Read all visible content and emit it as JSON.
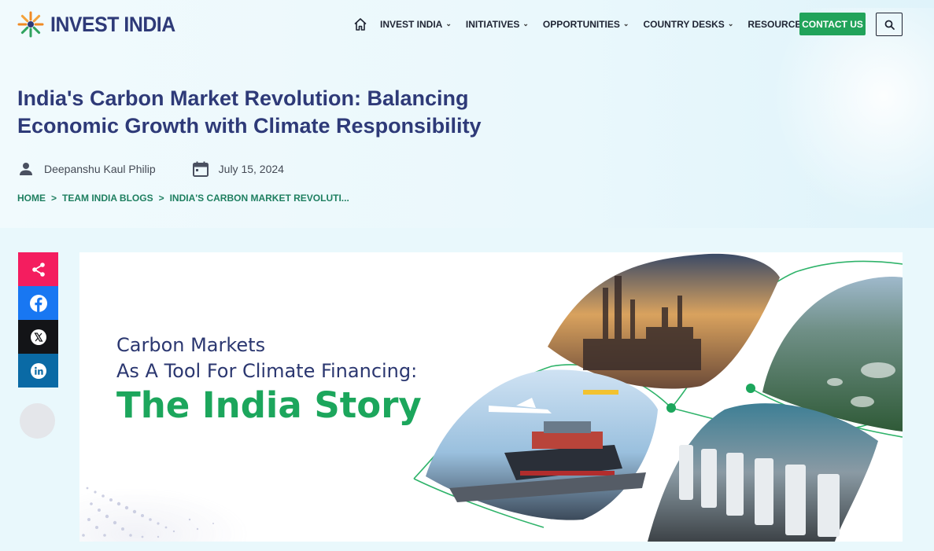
{
  "brand": {
    "name": "INVEST INDIA"
  },
  "nav": {
    "items": [
      {
        "label": "INVEST INDIA"
      },
      {
        "label": "INITIATIVES"
      },
      {
        "label": "OPPORTUNITIES"
      },
      {
        "label": "COUNTRY DESKS"
      },
      {
        "label": "RESOURCES"
      }
    ],
    "contact_label": "CONTACT US"
  },
  "article": {
    "title": "India's Carbon Market Revolution: Balancing Economic Growth with Climate Responsibility",
    "author": "Deepanshu Kaul Philip",
    "date": "July 15, 2024"
  },
  "breadcrumb": [
    {
      "label": "HOME"
    },
    {
      "label": "TEAM INDIA BLOGS"
    },
    {
      "label": "INDIA'S CARBON MARKET REVOLUTI..."
    }
  ],
  "banner": {
    "line1": "Carbon Markets",
    "line2": "As A Tool For Climate Financing:",
    "line3": "The India Story"
  },
  "colors": {
    "brand_navy": "#2e3a78",
    "accent_green": "#21a35a",
    "breadcrumb_green": "#1e7f60",
    "share_pink": "#f41d5f",
    "facebook_blue": "#1877f2",
    "x_black": "#131417",
    "linkedin_blue": "#0a6aa5"
  },
  "icons": [
    "home-icon",
    "chevron-down-icon",
    "search-icon",
    "user-icon",
    "calendar-icon",
    "share-icon",
    "facebook-icon",
    "x-icon",
    "linkedin-icon"
  ]
}
